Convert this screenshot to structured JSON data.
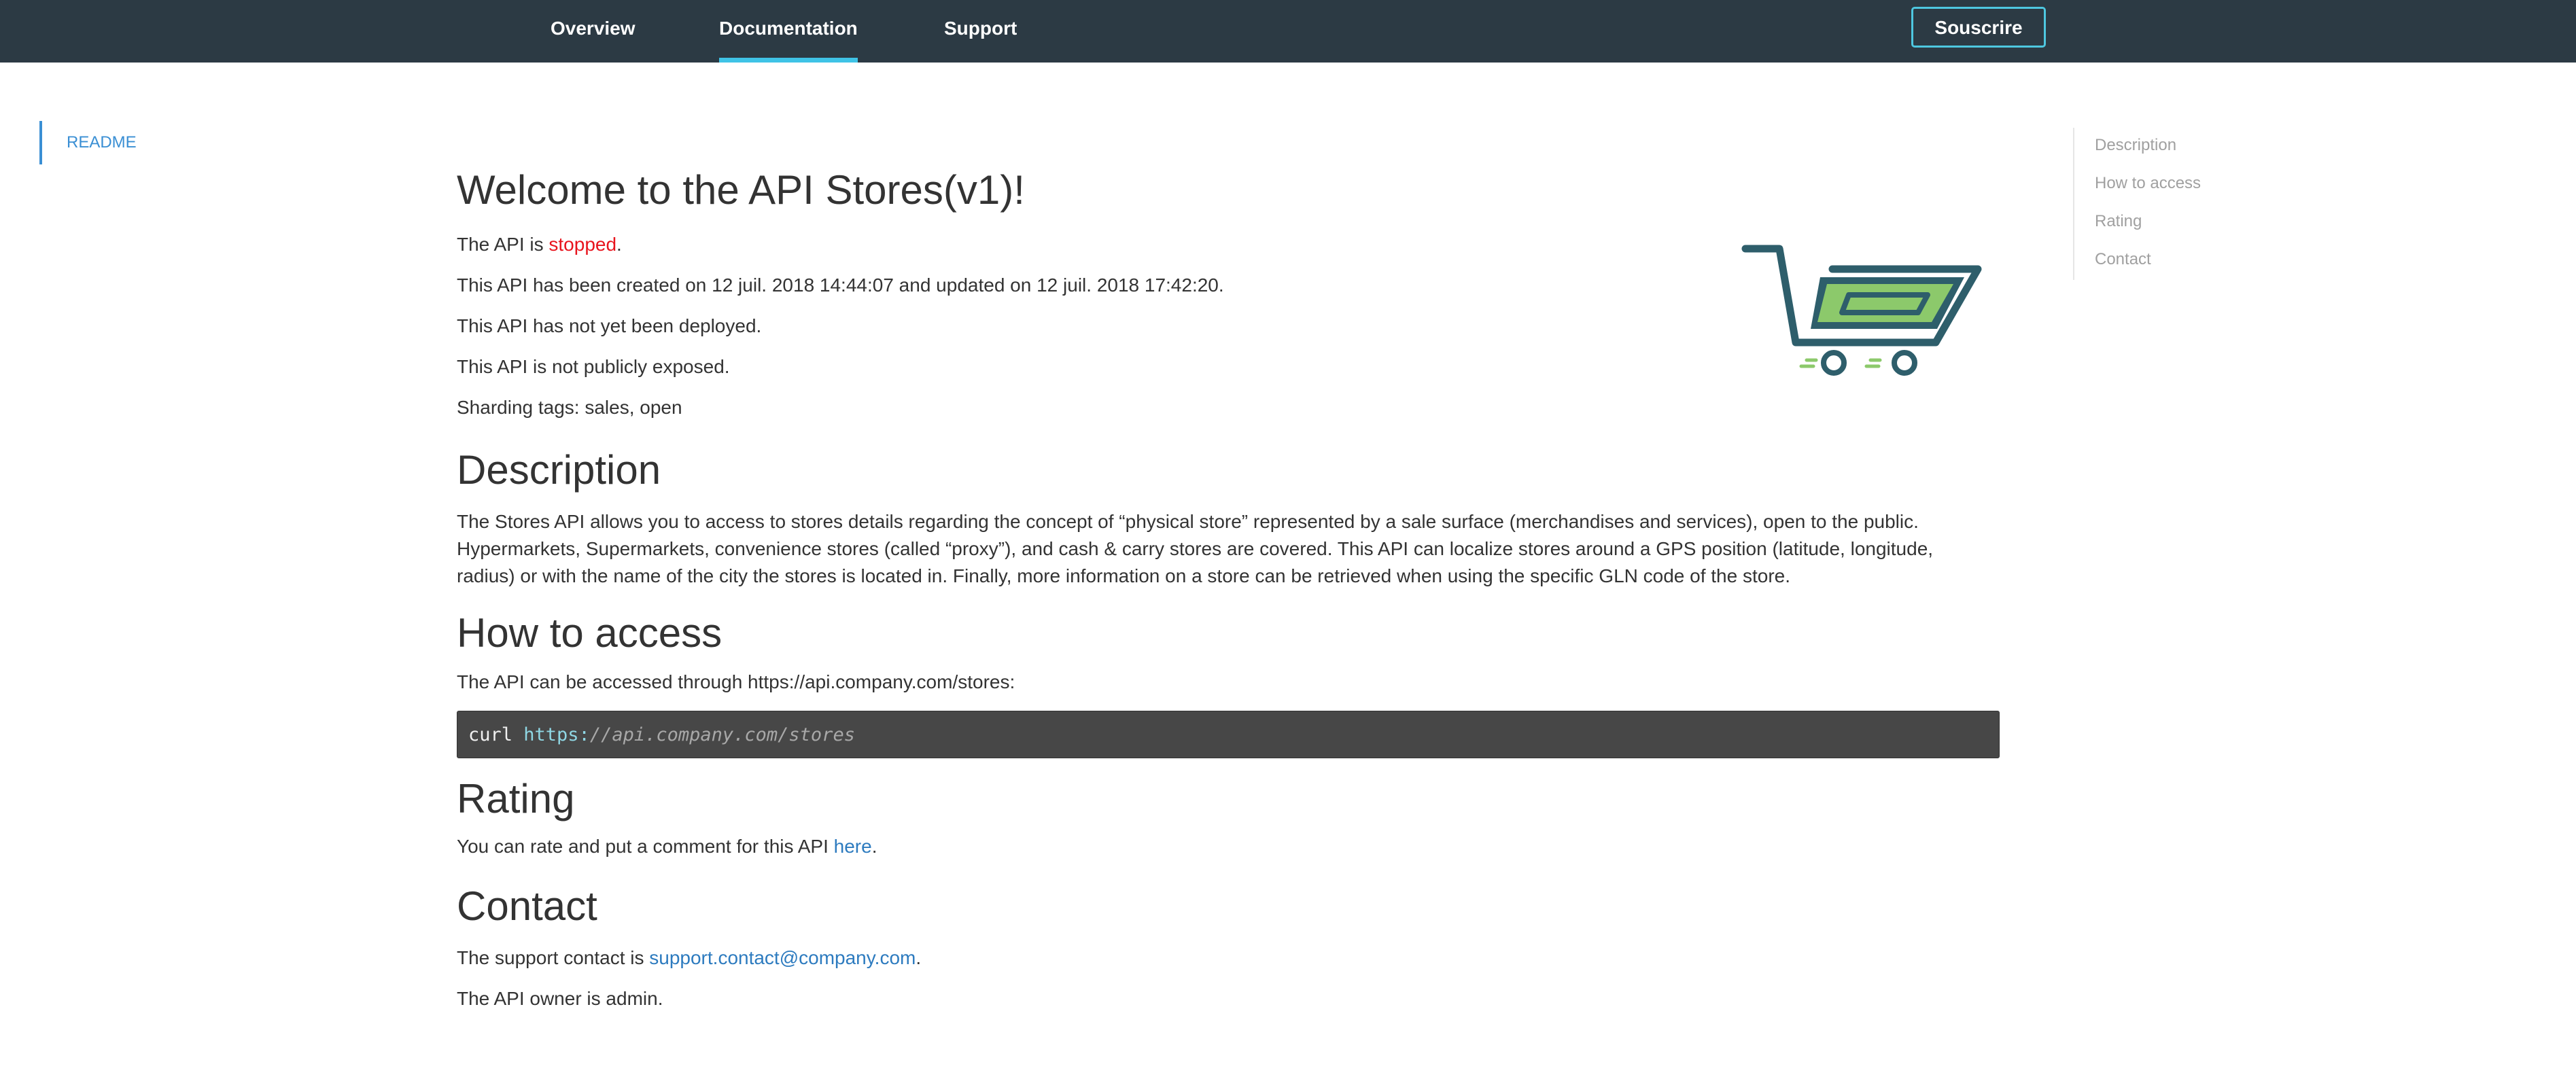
{
  "nav": {
    "tabs": [
      {
        "label": "Overview"
      },
      {
        "label": "Documentation"
      },
      {
        "label": "Support"
      }
    ],
    "active_tab": "Documentation",
    "subscribe_label": "Souscrire"
  },
  "sidebar": {
    "items": [
      {
        "label": "README"
      }
    ]
  },
  "toc": {
    "items": [
      {
        "label": "Description"
      },
      {
        "label": "How to access"
      },
      {
        "label": "Rating"
      },
      {
        "label": "Contact"
      }
    ]
  },
  "content": {
    "title": "Welcome to the API Stores(v1)!",
    "status_prefix": "The API is ",
    "status_value": "stopped",
    "status_suffix": ".",
    "created_line": "This API has been created on 12 juil. 2018 14:44:07 and updated on 12 juil. 2018 17:42:20.",
    "deployed_line": "This API has not yet been deployed.",
    "exposed_line": "This API is not publicly exposed.",
    "tags_line": "Sharding tags: sales, open",
    "description": {
      "heading": "Description",
      "text": "The Stores API allows you to access to stores details regarding the concept of “physical store” represented by a sale surface (merchandises and services), open to the public. Hypermarkets, Supermarkets, convenience stores (called “proxy”), and cash & carry stores are covered. This API can localize stores around a GPS position (latitude, longitude, radius) or with the name of the city the stores is located in. Finally, more information on a store can be retrieved when using the specific GLN code of the store."
    },
    "access": {
      "heading": "How to access",
      "text": "The API can be accessed through https://api.company.com/stores:",
      "code_cmd": "curl ",
      "code_proto": "https:",
      "code_path": "//api.company.com/stores"
    },
    "rating": {
      "heading": "Rating",
      "prefix": "You can rate and put a comment for this API ",
      "link_label": "here",
      "suffix": "."
    },
    "contact": {
      "heading": "Contact",
      "prefix": "The support contact is ",
      "email": "support.contact@company.com",
      "suffix": ".",
      "owner_line": "The API owner is admin."
    }
  },
  "logo": {
    "icon": "shopping-cart-icon",
    "colors": {
      "frame": "#2e5e6b",
      "fill": "#8cc96b",
      "speed_lines": "#8cc96b"
    }
  }
}
